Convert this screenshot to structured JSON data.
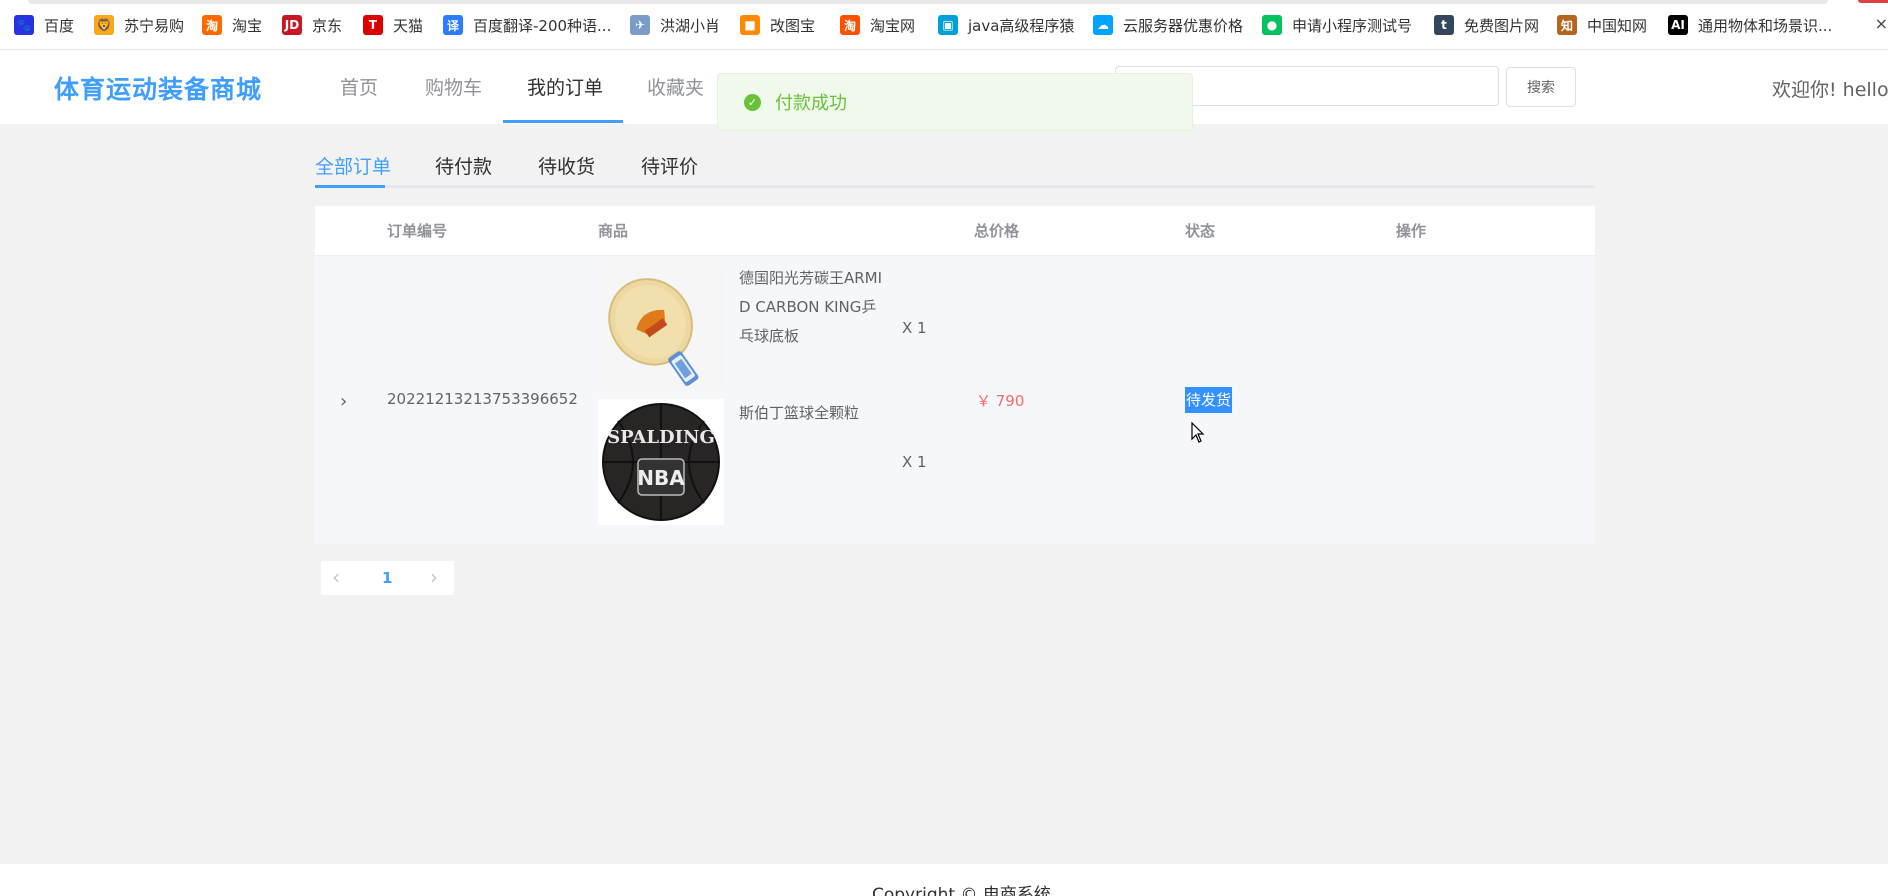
{
  "bookmarks": [
    {
      "label": "百度",
      "icon": "baidu-paw-icon",
      "glyph": "🐾",
      "color": "#2932e1"
    },
    {
      "label": "苏宁易购",
      "icon": "suning-lion-icon",
      "glyph": "🦁",
      "color": "#f7a81b"
    },
    {
      "label": "淘宝",
      "icon": "taobao-icon",
      "glyph": "淘",
      "color": "#ff6a00"
    },
    {
      "label": "京东",
      "icon": "jd-icon",
      "glyph": "JD",
      "color": "#c81623"
    },
    {
      "label": "天猫",
      "icon": "tmall-icon",
      "glyph": "T",
      "color": "#d00"
    },
    {
      "label": "百度翻译-200种语...",
      "icon": "baidu-translate-icon",
      "glyph": "译",
      "color": "#2c7cff"
    },
    {
      "label": "洪湖小肖",
      "icon": "bird-icon",
      "glyph": "✈",
      "color": "#7a9cc6"
    },
    {
      "label": "改图宝",
      "icon": "gaitubao-icon",
      "glyph": "■",
      "color": "#ff8a00"
    },
    {
      "label": "淘宝网",
      "icon": "taobao-net-icon",
      "glyph": "淘",
      "color": "#ff5000"
    },
    {
      "label": "java高级程序猿",
      "icon": "bilibili-tv-icon",
      "glyph": "▣",
      "color": "#00a1d6"
    },
    {
      "label": "云服务器优惠价格",
      "icon": "cloud-icon",
      "glyph": "☁",
      "color": "#00a3ff"
    },
    {
      "label": "申请小程序测试号",
      "icon": "wechat-icon",
      "glyph": "●",
      "color": "#07c160"
    },
    {
      "label": "免费图片网",
      "icon": "tumblr-icon",
      "glyph": "t",
      "color": "#35465c"
    },
    {
      "label": "中国知网",
      "icon": "cnki-icon",
      "glyph": "知",
      "color": "#b5651d"
    },
    {
      "label": "通用物体和场景识...",
      "icon": "ai-icon",
      "glyph": "AI",
      "color": "#000"
    }
  ],
  "header": {
    "logo": "体育运动装备商城",
    "nav": [
      "首页",
      "购物车",
      "我的订单",
      "收藏夹"
    ],
    "active_nav_index": 2,
    "search_placeholder": "",
    "search_button": "搜索",
    "welcome": "欢迎你!  hello"
  },
  "toast": {
    "message": "付款成功",
    "color": "#67c23a"
  },
  "tabs": {
    "items": [
      "全部订单",
      "待付款",
      "待收货",
      "待评价"
    ],
    "active_index": 0
  },
  "table": {
    "columns": [
      "订单编号",
      "商品",
      "总价格",
      "状态",
      "操作"
    ],
    "rows": [
      {
        "order_no": "20221213213753396652",
        "products": [
          {
            "name": "德国阳光芳碳王ARMID CARBON KING乒乓球底板",
            "qty": "X 1",
            "image": "table-tennis-racket-image"
          },
          {
            "name": "斯伯丁篮球全颗粒",
            "qty": "X 1",
            "image": "spalding-basketball-image"
          }
        ],
        "price": "￥ 790",
        "status": "待发货",
        "basketball_text": "SPALDING",
        "basketball_logo": "NBA"
      }
    ]
  },
  "pagination": {
    "current": "1"
  },
  "footer": {
    "copyright": "Copyright © 电商系统"
  },
  "colors": {
    "primary": "#409eff",
    "price": "#f56c6c",
    "status_highlight": "#3390ff"
  }
}
